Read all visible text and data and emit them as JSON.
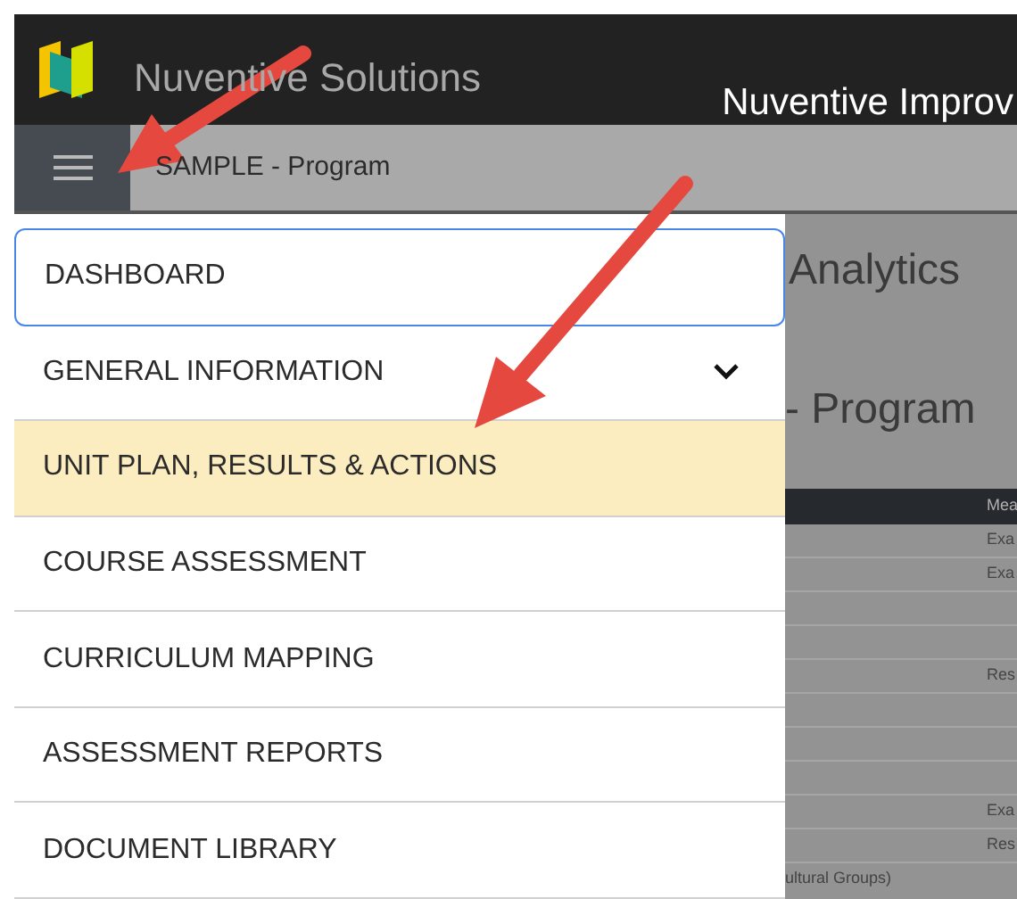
{
  "header": {
    "brand": "Nuventive Solutions",
    "app_title": "Nuventive Improv"
  },
  "toolbar": {
    "breadcrumb": "SAMPLE - Program"
  },
  "menu": {
    "items": [
      {
        "label": "DASHBOARD",
        "kind": "link",
        "selected": false,
        "focused": true
      },
      {
        "label": "GENERAL INFORMATION",
        "kind": "group",
        "expanded": false,
        "selected": false,
        "focused": false
      },
      {
        "label": "UNIT PLAN, RESULTS & ACTIONS",
        "kind": "link",
        "selected": true,
        "focused": false
      },
      {
        "label": "COURSE ASSESSMENT",
        "kind": "link",
        "selected": false,
        "focused": false
      },
      {
        "label": "CURRICULUM MAPPING",
        "kind": "link",
        "selected": false,
        "focused": false
      },
      {
        "label": "ASSESSMENT REPORTS",
        "kind": "link",
        "selected": false,
        "focused": false
      },
      {
        "label": "DOCUMENT LIBRARY",
        "kind": "link",
        "selected": false,
        "focused": false
      }
    ]
  },
  "page": {
    "heading": "Analytics",
    "subheading": "- Program",
    "table": {
      "column_2_header": "Mea",
      "rows": [
        {
          "column_2": "Exa"
        },
        {
          "column_2": "Exa"
        },
        {},
        {},
        {
          "column_2": "Res"
        },
        {},
        {},
        {},
        {
          "column_2": "Exa"
        },
        {
          "column_2": "Res"
        }
      ],
      "footer_text": "ultural Groups)"
    }
  }
}
